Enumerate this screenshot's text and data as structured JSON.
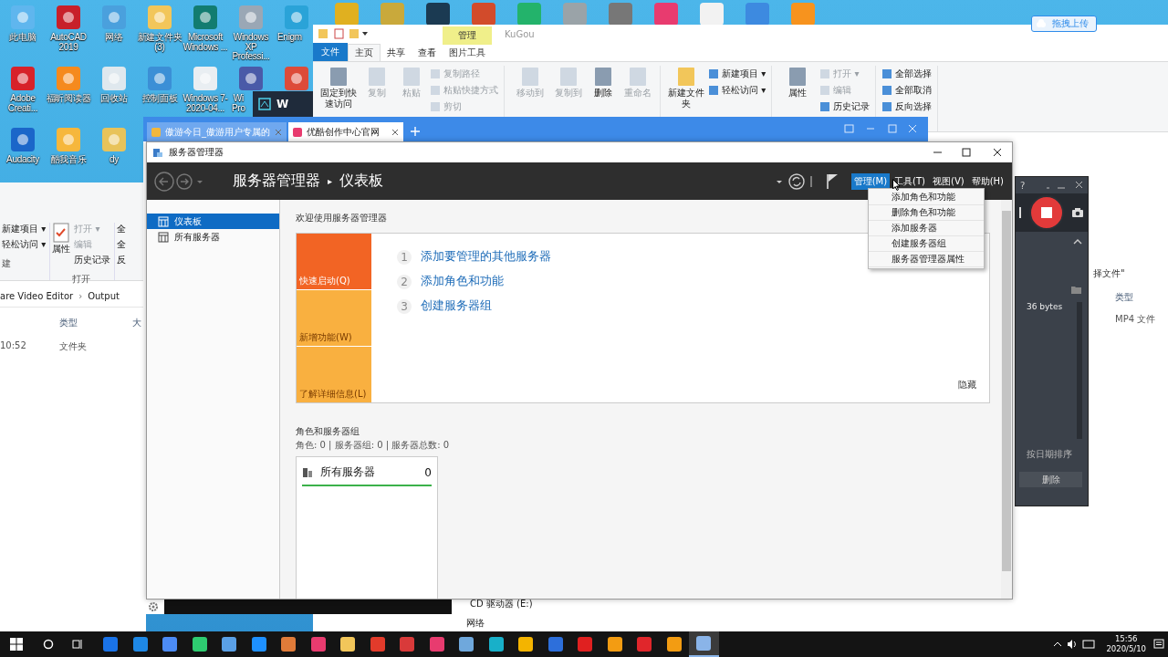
{
  "desktop": {
    "icons": [
      {
        "kind": "app",
        "label": "此电脑"
      },
      {
        "kind": "app",
        "label": "AutoCAD 2019"
      },
      {
        "kind": "app",
        "label": "网络"
      },
      {
        "kind": "app",
        "label": "新建文件夹 (3)"
      },
      {
        "kind": "app",
        "label": "Microsoft Windows ..."
      },
      {
        "kind": "app",
        "label": "Windows XP Professi..."
      },
      {
        "kind": "partial",
        "label": "Enigm"
      },
      {
        "kind": "app",
        "label": "Adobe Creati..."
      },
      {
        "kind": "app",
        "label": "福昕阅读器"
      },
      {
        "kind": "app",
        "label": "回收站"
      },
      {
        "kind": "app",
        "label": "控制面板"
      },
      {
        "kind": "app",
        "label": "Windows 7-2020-04..."
      },
      {
        "kind": "partial",
        "label": "Wi Pro"
      },
      {
        "kind": "covered"
      },
      {
        "kind": "app",
        "label": "Audacity"
      },
      {
        "kind": "app",
        "label": "酷我音乐"
      },
      {
        "kind": "app",
        "label": "dy"
      }
    ],
    "mini_window": {
      "title": "W"
    }
  },
  "left_explorer": {
    "ribbon_small": [
      {
        "label": "新建项目 ▾",
        "disabled": false
      },
      {
        "label": "轻松访问 ▾",
        "disabled": false
      }
    ],
    "ribbon_large": "属性",
    "ribbon_open": [
      {
        "label": "打开 ▾",
        "disabled": true
      },
      {
        "label": "编辑",
        "disabled": true
      },
      {
        "label": "历史记录",
        "disabled": false
      }
    ],
    "ribbon_select": [
      "全",
      "全",
      "反"
    ],
    "group_labels": [
      "建",
      "打开"
    ],
    "path": [
      "are Video Editor",
      "Output"
    ],
    "path_separator": "›",
    "columns": [
      "类型",
      "大"
    ],
    "rows": [
      {
        "time": "10:52",
        "type": "文件夹"
      }
    ]
  },
  "explorer": {
    "title": "KuGou",
    "tabs": [
      {
        "kind": "file",
        "label": "文件",
        "selected": false
      },
      {
        "kind": "normal",
        "label": "主页",
        "selected": true
      },
      {
        "kind": "normal",
        "label": "共享",
        "selected": false
      },
      {
        "kind": "normal",
        "label": "查看",
        "selected": false
      },
      {
        "kind": "context",
        "group": "管理",
        "label": "图片工具",
        "selected": false
      }
    ],
    "groups": [
      {
        "large": [
          {
            "label": "固定到快速访问",
            "disabled": false
          },
          {
            "label": "复制",
            "disabled": true
          },
          {
            "label": "粘贴",
            "disabled": true
          }
        ],
        "small": [
          {
            "label": "复制路径",
            "disabled": true
          },
          {
            "label": "粘贴快捷方式",
            "disabled": true
          },
          {
            "label": "剪切",
            "disabled": true
          }
        ]
      },
      {
        "large": [
          {
            "label": "移动到",
            "disabled": true
          },
          {
            "label": "复制到",
            "disabled": true
          },
          {
            "label": "删除",
            "disabled": false
          },
          {
            "label": "重命名",
            "disabled": true
          }
        ]
      },
      {
        "large": [
          {
            "label": "新建文件夹",
            "disabled": false
          }
        ],
        "small": [
          {
            "label": "新建项目 ▾",
            "disabled": false
          },
          {
            "label": "轻松访问 ▾",
            "disabled": false
          }
        ]
      },
      {
        "large": [
          {
            "label": "属性",
            "disabled": false
          }
        ],
        "small": [
          {
            "label": "打开 ▾",
            "disabled": true
          },
          {
            "label": "编辑",
            "disabled": true
          },
          {
            "label": "历史记录",
            "disabled": false
          }
        ]
      },
      {
        "small": [
          {
            "label": "全部选择",
            "disabled": false
          },
          {
            "label": "全部取消",
            "disabled": false
          },
          {
            "label": "反向选择",
            "disabled": false
          }
        ]
      }
    ],
    "upload_button": "拖拽上传",
    "search_text": "择文件\"",
    "columns": [
      "类型"
    ],
    "files": [
      {
        "type": "MP4 文件"
      }
    ],
    "nav": [
      "CD 驱动器 (E:)",
      "网络"
    ]
  },
  "browser": {
    "tabs": [
      {
        "label": "傲游今日_傲游用户专属的",
        "selected": false
      },
      {
        "label": "优酷创作中心官网",
        "selected": true
      }
    ]
  },
  "server_manager": {
    "title": "服务器管理器",
    "breadcrumb": [
      "服务器管理器",
      "仪表板"
    ],
    "breadcrumb_separator": "▸",
    "menus": [
      {
        "label": "管理(M)",
        "selected": true
      },
      {
        "label": "工具(T)",
        "selected": false
      },
      {
        "label": "视图(V)",
        "selected": false
      },
      {
        "label": "帮助(H)",
        "selected": false
      }
    ],
    "dropdown": [
      "添加角色和功能",
      "删除角色和功能",
      "添加服务器",
      "创建服务器组",
      "服务器管理器属性"
    ],
    "sidebar": [
      {
        "label": "仪表板",
        "selected": true
      },
      {
        "label": "所有服务器",
        "selected": false
      }
    ],
    "welcome": "欢迎使用服务器管理器",
    "tiles": [
      {
        "label": "快速启动(Q)",
        "selected": true
      },
      {
        "label": "新增功能(W)",
        "selected": false
      },
      {
        "label": "了解详细信息(L)",
        "selected": false
      }
    ],
    "steps": [
      {
        "number": "1",
        "label": "添加要管理的其他服务器"
      },
      {
        "number": "2",
        "label": "添加角色和功能"
      },
      {
        "number": "3",
        "label": "创建服务器组"
      }
    ],
    "hide": "隐藏",
    "section_title": "角色和服务器组",
    "summary": "角色: 0 | 服务器组: 0 | 服务器总数: 0",
    "cards": [
      {
        "title": "所有服务器",
        "count": "0"
      }
    ]
  },
  "recorder": {
    "help": "?",
    "size": "36 bytes",
    "sort": "按日期排序",
    "delete": "删除"
  },
  "taskbar": {
    "time": "15:56",
    "date": "2020/5/10"
  }
}
